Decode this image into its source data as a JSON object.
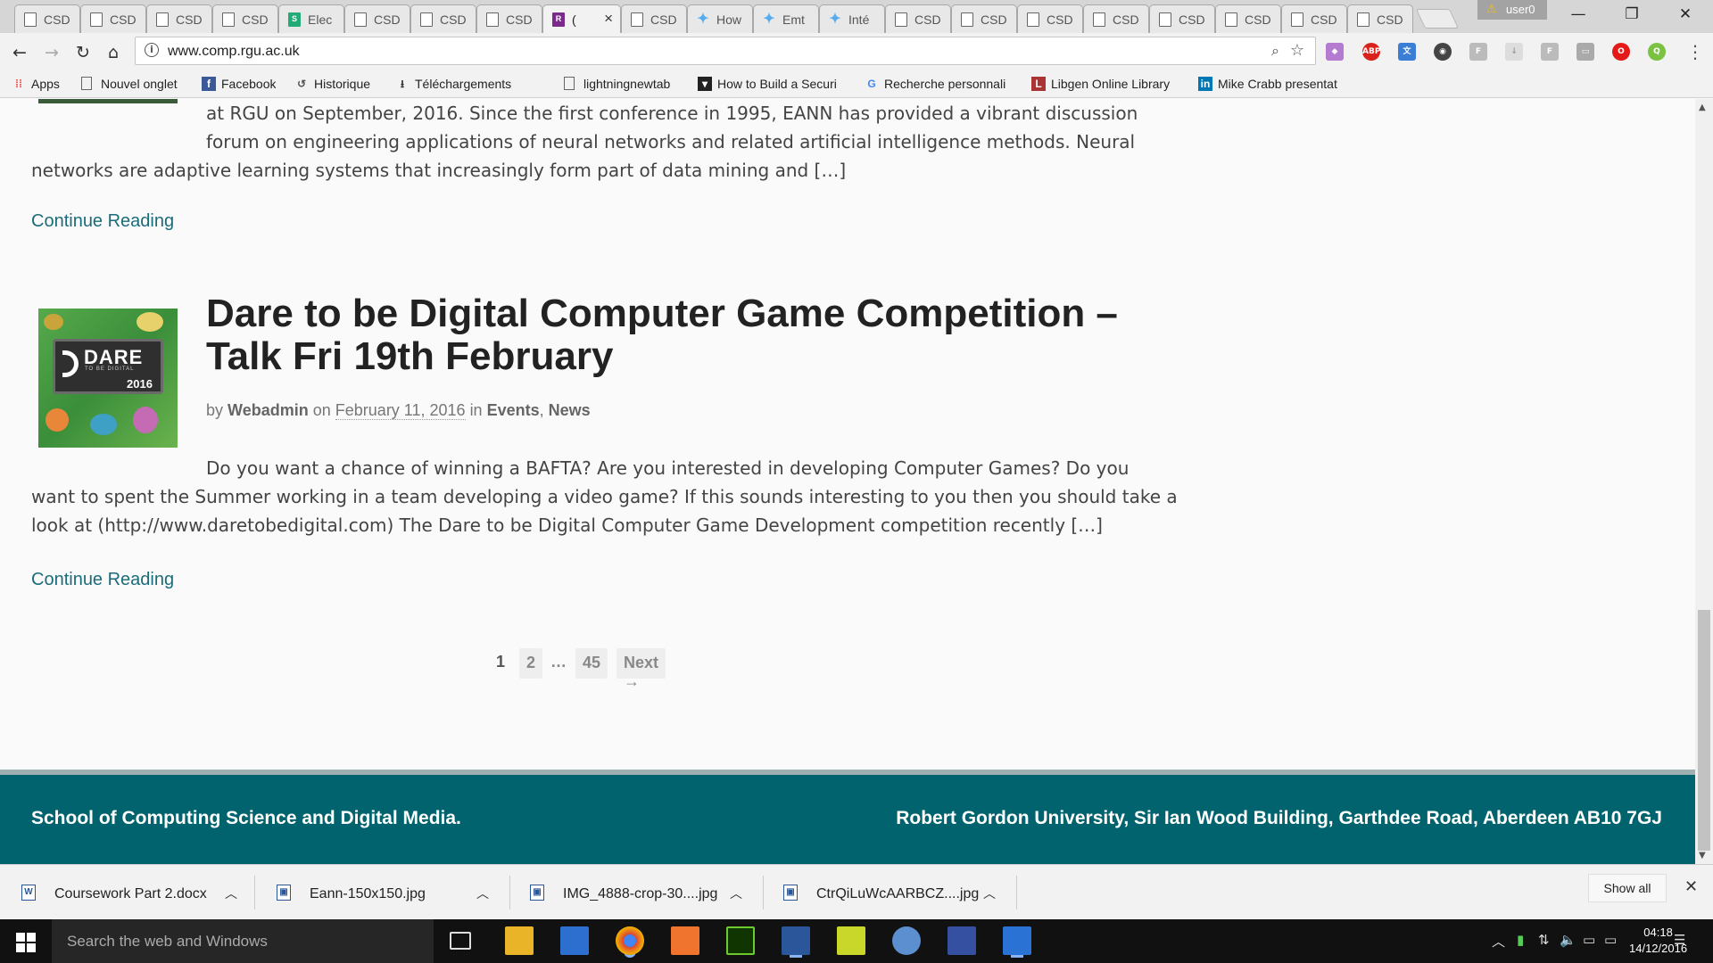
{
  "browser": {
    "tabs": [
      {
        "label": "CSD",
        "icon": "page-icon"
      },
      {
        "label": "CSD",
        "icon": "page-icon"
      },
      {
        "label": "CSD",
        "icon": "page-icon"
      },
      {
        "label": "CSD",
        "icon": "page-icon"
      },
      {
        "label": "Elec",
        "icon": "s-logo-icon"
      },
      {
        "label": "CSD",
        "icon": "page-icon"
      },
      {
        "label": "CSD",
        "icon": "page-icon"
      },
      {
        "label": "CSD",
        "icon": "page-icon"
      },
      {
        "label": "(",
        "icon": "rgu-icon",
        "active": true
      },
      {
        "label": "CSD",
        "icon": "page-icon"
      },
      {
        "label": "How",
        "icon": "twitter-icon"
      },
      {
        "label": "Emt",
        "icon": "twitter-icon"
      },
      {
        "label": "Inté",
        "icon": "twitter-icon"
      },
      {
        "label": "CSD",
        "icon": "page-icon"
      },
      {
        "label": "CSD",
        "icon": "page-icon"
      },
      {
        "label": "CSD",
        "icon": "page-icon"
      },
      {
        "label": "CSD",
        "icon": "page-icon"
      },
      {
        "label": "CSD",
        "icon": "page-icon"
      },
      {
        "label": "CSD",
        "icon": "page-icon"
      },
      {
        "label": "CSD",
        "icon": "page-icon"
      },
      {
        "label": "CSD",
        "icon": "page-icon"
      }
    ],
    "user_label": "user0",
    "url": "www.comp.rgu.ac.uk",
    "bookmarks": [
      {
        "label": "Apps",
        "icon": "apps-grid-icon"
      },
      {
        "label": "Nouvel onglet",
        "icon": "page-icon"
      },
      {
        "label": "Facebook",
        "icon": "facebook-icon"
      },
      {
        "label": "Historique",
        "icon": "history-icon"
      },
      {
        "label": "Téléchargements",
        "icon": "download-icon"
      },
      {
        "label": "",
        "icon": "page-icon"
      },
      {
        "label": "lightningnewtab",
        "icon": "page-icon"
      },
      {
        "label": "How to Build a Securi",
        "icon": "bookmark-icon"
      },
      {
        "label": "Recherche personnali",
        "icon": "google-icon"
      },
      {
        "label": "Libgen Online Library",
        "icon": "library-icon"
      },
      {
        "label": "Mike Crabb presentat",
        "icon": "linkedin-icon"
      }
    ]
  },
  "page": {
    "prev_post": {
      "excerpt_lines": [
        "at RGU on September, 2016. Since the first conference in 1995, EANN has provided a vibrant discussion",
        "forum on engineering applications of neural networks and related artificial intelligence methods. Neural",
        "networks are adaptive learning systems that increasingly form part of data mining and […]"
      ],
      "continue_label": "Continue Reading"
    },
    "post": {
      "title_line1": "Dare to be Digital Computer Game Competition –",
      "title_line2": "Talk Fri 19th February",
      "by": "by",
      "author": "Webadmin",
      "on": "on",
      "date": "February 11, 2016",
      "in": "in",
      "cat1": "Events",
      "comma": ",",
      "cat2": "News",
      "thumb_text": {
        "word": "DARE",
        "sub": "TO BE DIGITAL",
        "year": "2016"
      },
      "excerpt_lines": [
        "Do you want a chance of winning a BAFTA? Are you interested in developing Computer Games? Do you",
        "want to spent the Summer working in a team developing a video game? If this sounds interesting to you then you should take a",
        "look at (http://www.daretobedigital.com) The Dare to be Digital Computer Game Development competition recently […]"
      ],
      "continue_label": "Continue Reading"
    },
    "pagination": {
      "current": "1",
      "page2": "2",
      "ellipsis": "…",
      "last": "45",
      "next": "Next →"
    },
    "footer": {
      "left": "School of Computing Science and Digital Media.",
      "right": "Robert Gordon University, Sir Ian Wood Building, Garthdee Road, Aberdeen AB10 7GJ"
    }
  },
  "downloads": {
    "items": [
      {
        "name": "Coursework Part 2.docx",
        "icon": "word-doc-icon"
      },
      {
        "name": "Eann-150x150.jpg",
        "icon": "image-file-icon"
      },
      {
        "name": "IMG_4888-crop-30....jpg",
        "icon": "image-file-icon"
      },
      {
        "name": "CtrQiLuWcAARBCZ....jpg",
        "icon": "image-file-icon"
      }
    ],
    "show_all": "Show all"
  },
  "taskbar": {
    "search_placeholder": "Search the web and Windows",
    "time": "04:18",
    "date": "14/12/2016"
  }
}
